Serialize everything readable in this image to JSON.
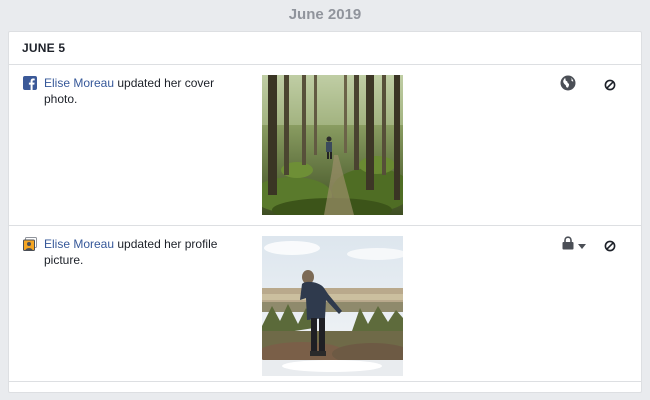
{
  "month": "June 2019",
  "day": "JUNE 5",
  "entries": [
    {
      "icon": "facebook-icon",
      "name": "Elise Moreau",
      "action": " updated her cover photo.",
      "photo": "forest-trail-photo",
      "privacy": "public-globe-icon"
    },
    {
      "icon": "profile-picture-icon",
      "name": "Elise Moreau",
      "action": " updated her profile picture.",
      "photo": "hilltop-woman-photo",
      "privacy": "only-me-lock-icon"
    }
  ],
  "colors": {
    "link": "#365899",
    "facebook_blue": "#3b5998",
    "background": "#e9ebee",
    "border": "#dddfe2"
  }
}
